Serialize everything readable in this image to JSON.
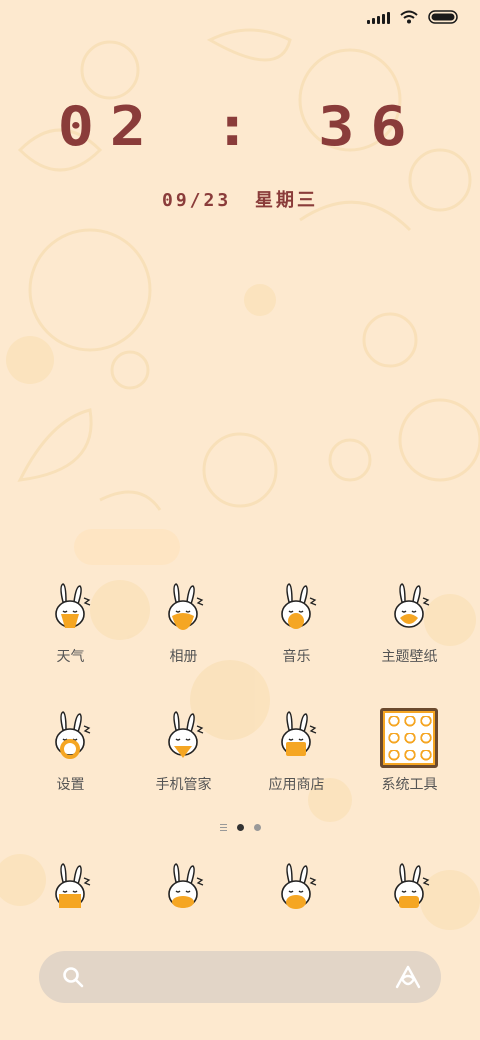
{
  "status_bar": {
    "signal_icon": "signal-bars-icon",
    "wifi_icon": "wifi-icon",
    "battery_icon": "battery-icon",
    "battery_level_percent": 100
  },
  "lockclock": {
    "time": "02 : 36",
    "date": "09/23",
    "weekday": "星期三"
  },
  "ghost_widget": {
    "text": ""
  },
  "apps_row1": [
    {
      "label": "天气",
      "icon": "bunny-weather-icon"
    },
    {
      "label": "相册",
      "icon": "bunny-album-icon"
    },
    {
      "label": "音乐",
      "icon": "bunny-music-icon"
    },
    {
      "label": "主题壁纸",
      "icon": "bunny-theme-icon"
    }
  ],
  "apps_row2": [
    {
      "label": "设置",
      "icon": "bunny-settings-icon"
    },
    {
      "label": "手机管家",
      "icon": "bunny-security-icon"
    },
    {
      "label": "应用商店",
      "icon": "bunny-store-icon"
    },
    {
      "label": "系统工具",
      "icon": "folder-icon"
    }
  ],
  "dock": [
    {
      "icon": "bunny-phone-icon"
    },
    {
      "icon": "bunny-messages-icon"
    },
    {
      "icon": "bunny-browser-icon"
    },
    {
      "icon": "bunny-camera-icon"
    }
  ],
  "page_indicator": {
    "pages": 2,
    "current": 1
  },
  "search_bar": {
    "search_icon": "search-icon",
    "assistant_icon": "assistant-icon"
  },
  "colors": {
    "background": "#fde9cf",
    "clock": "#8a3c3a",
    "accent": "#f5a623",
    "label": "#555555"
  }
}
